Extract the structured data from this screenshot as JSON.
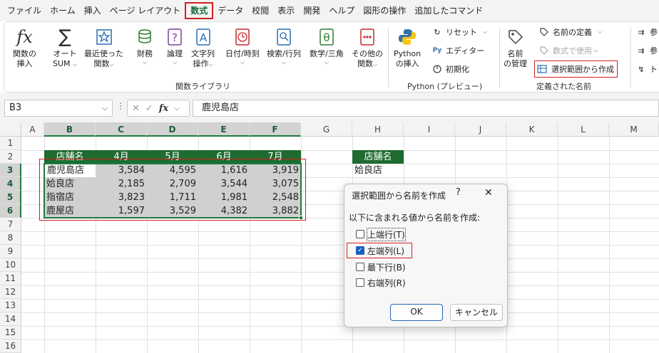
{
  "menu": [
    {
      "label": "ファイル",
      "active": false
    },
    {
      "label": "ホーム",
      "active": false
    },
    {
      "label": "挿入",
      "active": false
    },
    {
      "label": "ページ レイアウト",
      "active": false
    },
    {
      "label": "数式",
      "active": true
    },
    {
      "label": "データ",
      "active": false
    },
    {
      "label": "校閲",
      "active": false
    },
    {
      "label": "表示",
      "active": false
    },
    {
      "label": "開発",
      "active": false
    },
    {
      "label": "ヘルプ",
      "active": false
    },
    {
      "label": "図形の操作",
      "active": false
    },
    {
      "label": "追加したコマンド",
      "active": false
    }
  ],
  "ribbon": {
    "function_library": {
      "insert_function": {
        "line1": "関数の",
        "line2": "挿入"
      },
      "autosum": {
        "line1": "オート",
        "line2": "SUM"
      },
      "recent": {
        "line1": "最近使った",
        "line2": "関数"
      },
      "financial": {
        "line1": "財務"
      },
      "logical": {
        "line1": "論理"
      },
      "text": {
        "line1": "文字列",
        "line2": "操作"
      },
      "datetime": {
        "line1": "日付/時刻"
      },
      "lookup": {
        "line1": "検索/行列"
      },
      "math": {
        "line1": "数学/三角"
      },
      "more": {
        "line1": "その他の",
        "line2": "関数"
      },
      "group_label": "関数ライブラリ"
    },
    "python": {
      "insert": {
        "line1": "Python",
        "line2": "の挿入"
      },
      "reset": "リセット",
      "editor": "エディター",
      "initialize": "初期化",
      "group_label": "Python (プレビュー)"
    },
    "defined_names": {
      "name_manager": {
        "line1": "名前",
        "line2": "の管理"
      },
      "define_name": "名前の定義",
      "use_in_formula": "数式で使用",
      "create_from_selection": "選択範囲から作成",
      "group_label": "定義された名前"
    },
    "audit_partial": {
      "ref1": "参",
      "ref2": "参",
      "trace": "トレ"
    }
  },
  "formula_bar": {
    "name_box": "B3",
    "cancel_icon": "✕",
    "enter_icon": "✓",
    "fx": "fx",
    "value": "鹿児島店"
  },
  "sheet": {
    "columns": [
      "A",
      "B",
      "C",
      "D",
      "E",
      "F",
      "G",
      "H",
      "I",
      "J",
      "K",
      "L",
      "M"
    ],
    "rows": [
      "1",
      "2",
      "3",
      "4",
      "5",
      "6",
      "7",
      "8",
      "9",
      "10",
      "11",
      "12",
      "13",
      "14",
      "15",
      "16"
    ],
    "table_headers": [
      "店舗名",
      "4月",
      "5月",
      "6月",
      "7月"
    ],
    "table_rows": [
      {
        "store": "鹿児島店",
        "values": [
          "3,584",
          "4,595",
          "1,616",
          "3,919"
        ]
      },
      {
        "store": "姶良店",
        "values": [
          "2,185",
          "2,709",
          "3,544",
          "3,075"
        ]
      },
      {
        "store": "指宿店",
        "values": [
          "3,823",
          "1,711",
          "1,981",
          "2,548"
        ]
      },
      {
        "store": "鹿屋店",
        "values": [
          "1,597",
          "3,529",
          "4,382",
          "3,882"
        ]
      }
    ],
    "h2": "店舗名",
    "h3": "姶良店"
  },
  "dialog": {
    "title": "選択範囲から名前を作成",
    "help": "?",
    "close": "✕",
    "prompt": "以下に含まれる値から名前を作成:",
    "options": [
      {
        "label": "上端行(T)",
        "checked": false
      },
      {
        "label": "左端列(L)",
        "checked": true
      },
      {
        "label": "最下行(B)",
        "checked": false
      },
      {
        "label": "右端列(R)",
        "checked": false
      }
    ],
    "ok": "OK",
    "cancel": "キャンセル"
  },
  "colors": {
    "accent": "#1f6b30",
    "highlight": "#d42020",
    "check": "#1a5fbd"
  }
}
